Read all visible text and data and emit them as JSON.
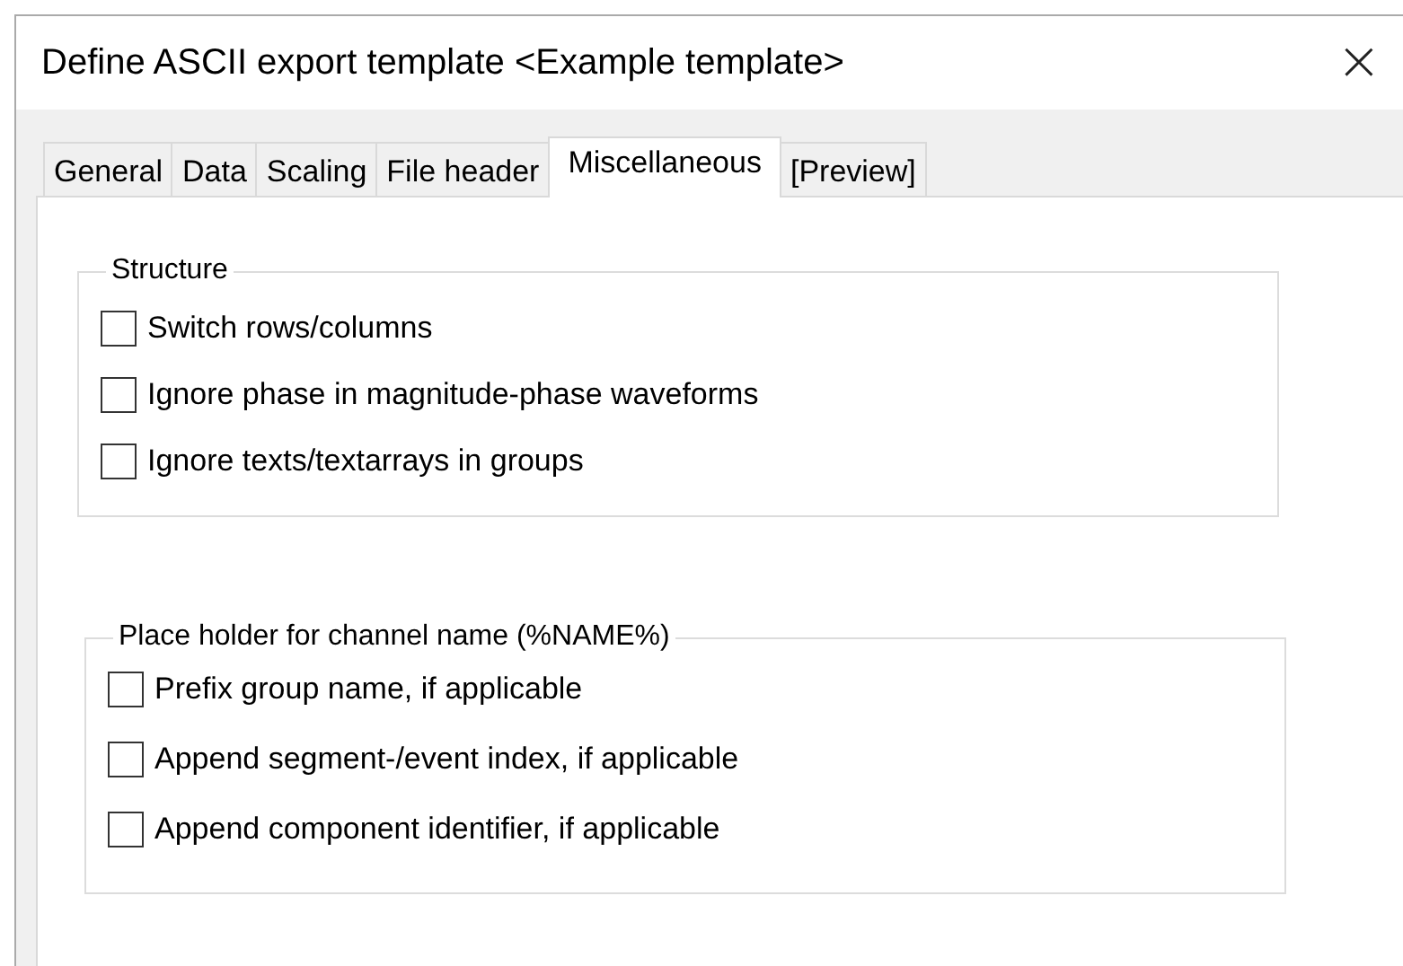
{
  "window": {
    "title": "Define ASCII export template <Example template>",
    "close": "×"
  },
  "tabs": [
    {
      "label": "General",
      "selected": false
    },
    {
      "label": "Data",
      "selected": false
    },
    {
      "label": "Scaling",
      "selected": false
    },
    {
      "label": "File header",
      "selected": false
    },
    {
      "label": "Miscellaneous",
      "selected": true
    },
    {
      "label": "[Preview]",
      "selected": false
    }
  ],
  "groups": [
    {
      "title": "Structure",
      "options": [
        {
          "label": "Switch rows/columns",
          "checked": false
        },
        {
          "label": "Ignore phase in magnitude-phase waveforms",
          "checked": false
        },
        {
          "label": "Ignore texts/textarrays in groups",
          "checked": false
        }
      ]
    },
    {
      "title": "Place holder for channel name (%NAME%)",
      "options": [
        {
          "label": "Prefix group name, if applicable",
          "checked": false
        },
        {
          "label": "Append segment-/event index, if applicable",
          "checked": false
        },
        {
          "label": "Append component identifier, if applicable",
          "checked": false
        }
      ]
    }
  ]
}
